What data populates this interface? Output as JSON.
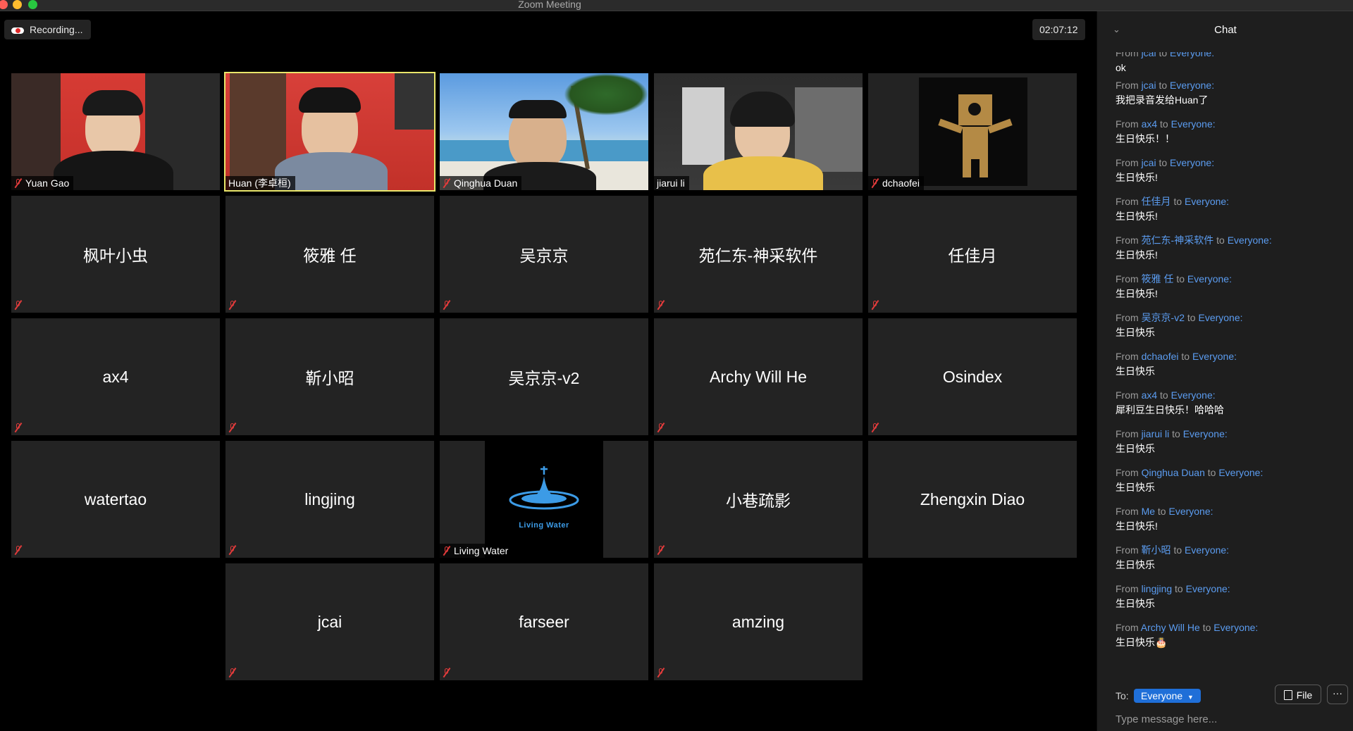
{
  "window": {
    "title": "Zoom Meeting"
  },
  "meeting": {
    "recording_label": "Recording...",
    "timer": "02:07:12"
  },
  "participants": {
    "row1": [
      "Yuan Gao",
      "Huan (李卓桓)",
      "Qinghua Duan",
      "jiarui li",
      "dchaofei"
    ],
    "row2": [
      "枫叶小虫",
      "筱雅 任",
      "吴京京",
      "苑仁东-神采软件",
      "任佳月"
    ],
    "row3": [
      "ax4",
      "靳小昭",
      "吴京京-v2",
      "Archy Will He",
      "Osindex"
    ],
    "row4": [
      "watertao",
      "lingjing",
      "Living Water",
      "小巷疏影",
      "Zhengxin Diao"
    ],
    "row5": [
      "jcai",
      "farseer",
      "amzing"
    ],
    "living_water_logo_text": "Living Water"
  },
  "chat": {
    "title": "Chat",
    "from_word": "From",
    "to_word": "to",
    "messages": [
      {
        "sender": "jcai",
        "recipient": "Everyone:",
        "text": "ok"
      },
      {
        "sender": "jcai",
        "recipient": "Everyone:",
        "text": "我把录音发给Huan了"
      },
      {
        "sender": "ax4",
        "recipient": "Everyone:",
        "text": "生日快乐！！"
      },
      {
        "sender": "jcai",
        "recipient": "Everyone:",
        "text": "生日快乐!"
      },
      {
        "sender": "任佳月",
        "recipient": "Everyone:",
        "text": "生日快乐!"
      },
      {
        "sender": "苑仁东-神采软件",
        "recipient": "Everyone:",
        "text": "生日快乐!"
      },
      {
        "sender": "筱雅 任",
        "recipient": "Everyone:",
        "text": "生日快乐!"
      },
      {
        "sender": "吴京京-v2",
        "recipient": "Everyone:",
        "text": "生日快乐"
      },
      {
        "sender": "dchaofei",
        "recipient": "Everyone:",
        "text": "生日快乐"
      },
      {
        "sender": "ax4",
        "recipient": "Everyone:",
        "text": "犀利豆生日快乐！哈哈哈"
      },
      {
        "sender": "jiarui li",
        "recipient": "Everyone:",
        "text": "生日快乐"
      },
      {
        "sender": "Qinghua Duan",
        "recipient": "Everyone:",
        "text": "生日快乐"
      },
      {
        "sender": "Me",
        "recipient": "Everyone:",
        "text": "生日快乐!"
      },
      {
        "sender": "靳小昭",
        "recipient": "Everyone:",
        "text": "生日快乐"
      },
      {
        "sender": "lingjing",
        "recipient": "Everyone:",
        "text": "生日快乐"
      },
      {
        "sender": "Archy Will He",
        "recipient": "Everyone:",
        "text": "生日快乐🎂"
      }
    ],
    "to_label": "To:",
    "recipient_select": "Everyone",
    "file_button": "File",
    "more_button": "···",
    "input_placeholder": "Type message here..."
  },
  "colors": {
    "accent": "#1f6fd8",
    "active_speaker": "#e9e66a",
    "muted": "#e23b3b",
    "link": "#5b9cf0"
  }
}
